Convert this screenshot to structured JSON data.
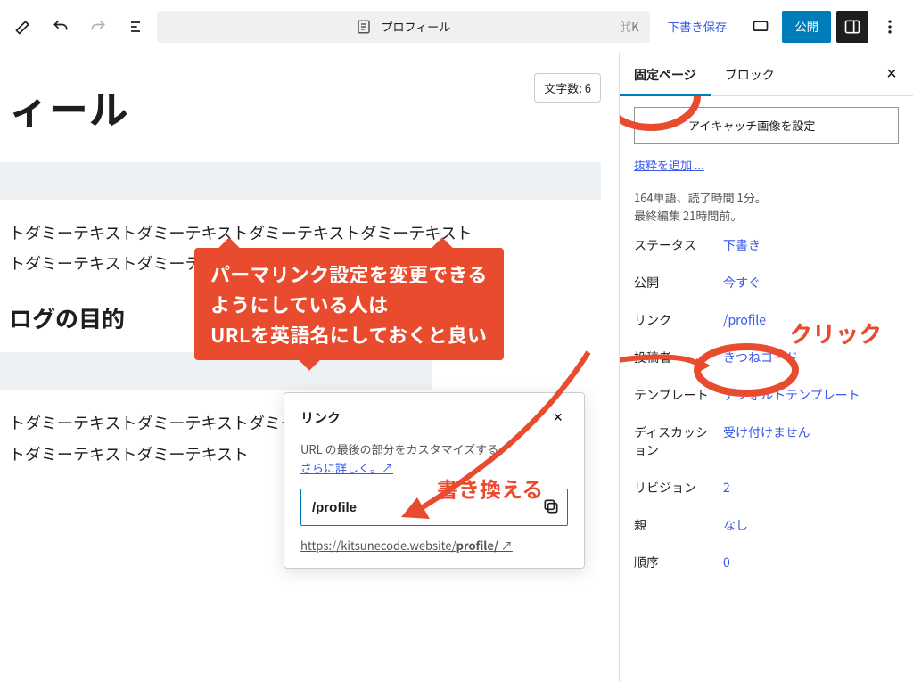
{
  "topbar": {
    "doc_title": "プロフィール",
    "kbd": "⌘K",
    "save_draft": "下書き保存",
    "publish": "公開"
  },
  "canvas": {
    "word_count": "文字数: 6",
    "title_fragment": "ィール",
    "dummy_line1": "トダミーテキストダミーテキストダミーテキストダミーテキスト",
    "dummy_line2": "トダミーテキストダミーテキスト",
    "h2_fragment": "ログの目的",
    "dummy_line3": "トダミーテキストダミーテキストダミーテキストダミーテキスト",
    "dummy_line4": "トダミーテキストダミーテキスト"
  },
  "popover": {
    "title": "リンク",
    "desc": "URL の最後の部分をカスタマイズする。",
    "learn_more": "さらに詳しく。↗",
    "slug": "/profile",
    "permalink_prefix": "https://kitsunecode.website/",
    "permalink_slug": "profile/",
    "permalink_suffix": " ↗"
  },
  "inspector": {
    "tab_page": "固定ページ",
    "tab_block": "ブロック",
    "featured": "アイキャッチ画像を設定",
    "excerpt": "抜粋を追加 ...",
    "stats_words": "164単語、読了時間 1分。",
    "stats_edited": "最終編集 21時間前。",
    "rows": {
      "status_k": "ステータス",
      "status_v": "下書き",
      "publish_k": "公開",
      "publish_v": "今すぐ",
      "link_k": "リンク",
      "link_v": "/profile",
      "author_k": "投稿者",
      "author_v": "きつねコード",
      "template_k": "テンプレート",
      "template_v": "デフォルトテンプレート",
      "discussion_k": "ディスカッション",
      "discussion_v": "受け付けません",
      "revision_k": "リビジョン",
      "revision_v": "2",
      "parent_k": "親",
      "parent_v": "なし",
      "order_k": "順序",
      "order_v": "0"
    }
  },
  "annotations": {
    "callout_l1": "パーマリンク設定を変更できる",
    "callout_l2": "ようにしている人は",
    "callout_l3": "URLを英語名にしておくと良い",
    "rewrite": "書き換える",
    "click": "クリック"
  }
}
